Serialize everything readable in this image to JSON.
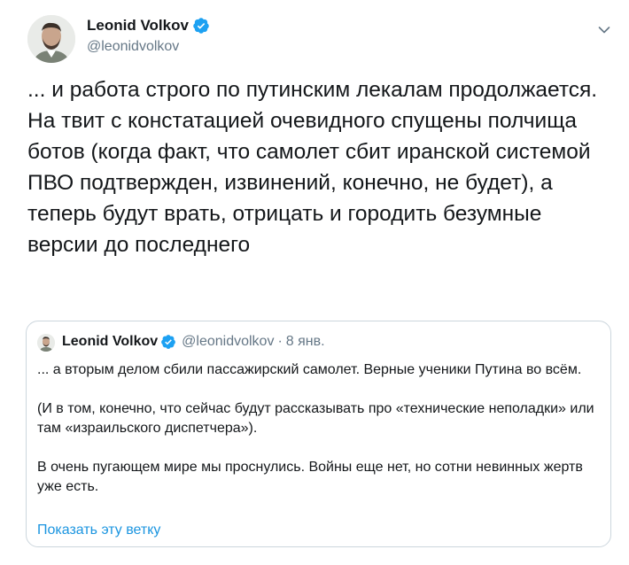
{
  "tweet": {
    "author": {
      "name": "Leonid Volkov",
      "handle": "@leonidvolkov",
      "verified": true
    },
    "text": "... и работа строго по путинским лекалам продолжается. На твит с констатацией очевидного спущены полчища ботов (когда факт, что самолет сбит иранской системой ПВО подтвержден, извинений, конечно, не будет), а теперь будут врать, отрицать и городить безумные версии до последнего",
    "quoted": {
      "name": "Leonid Volkov",
      "handle": "@leonidvolkov",
      "separator": "·",
      "date": "8 янв.",
      "paragraphs": [
        "... а вторым делом сбили пассажирский самолет. Верные ученики Путина во всём.",
        "(И в том, конечно, что сейчас будут рассказывать про «технические неполадки» или там «израильского диспетчера»).",
        "В очень пугающем мире мы проснулись. Войны еще нет, но сотни невинных жертв уже есть."
      ],
      "show_thread_label": "Показать эту ветку"
    }
  },
  "colors": {
    "verified_badge": "#1da1f2",
    "link": "#1b95e0",
    "secondary_text": "#657786",
    "border": "#ccd6dd"
  }
}
